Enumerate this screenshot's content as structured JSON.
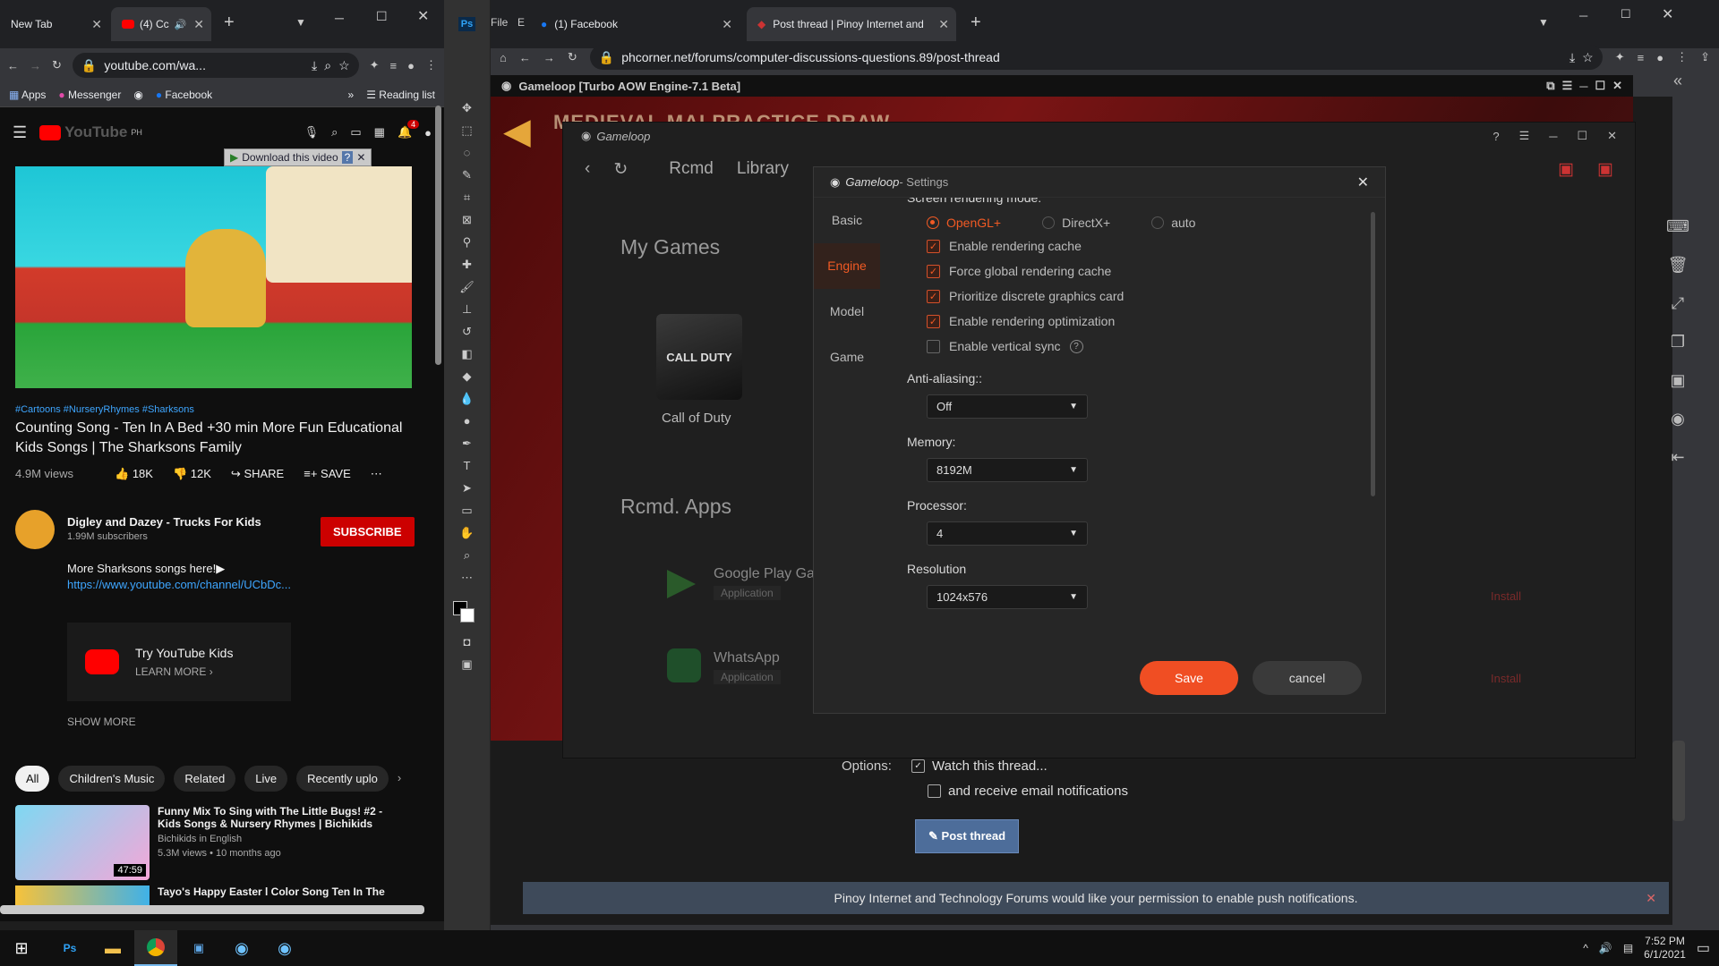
{
  "left_browser": {
    "tabs": [
      {
        "label": "New Tab"
      },
      {
        "label": "(4) Cc"
      }
    ],
    "url": "youtube.com/wa...",
    "bookmarks": {
      "apps": "Apps",
      "messenger": "Messenger",
      "facebook": "Facebook",
      "reading_list": "Reading list"
    },
    "youtube": {
      "region": "PH",
      "notification_count": "4",
      "download_label": "Download this video",
      "tags": "#Cartoons #NurseryRhymes #Sharksons",
      "title": "Counting Song - Ten In A Bed +30 min More Fun Educational Kids Songs | The Sharksons Family",
      "views": "4.9M views",
      "likes": "18K",
      "dislikes": "12K",
      "share": "SHARE",
      "save": "SAVE",
      "channel": "Digley and Dazey - Trucks For Kids",
      "subscribers": "1.99M subscribers",
      "subscribe": "SUBSCRIBE",
      "description": "More Sharksons songs here!▶",
      "description_link": "https://www.youtube.com/channel/UCbDc...",
      "kids_title": "Try YouTube Kids",
      "kids_cta": "LEARN MORE",
      "show_more": "SHOW MORE",
      "chips": [
        "All",
        "Children's Music",
        "Related",
        "Live",
        "Recently uplo"
      ],
      "videos": [
        {
          "title": "Funny Mix To Sing with The Little Bugs! #2 - Kids Songs & Nursery Rhymes | Bichikids",
          "channel": "Bichikids in English",
          "meta": "5.3M views • 10 months ago",
          "duration": "47:59"
        },
        {
          "title": "Tayo's Happy Easter l Color Song Ten In The",
          "channel": "",
          "meta": "",
          "duration": ""
        }
      ]
    }
  },
  "right_browser": {
    "ps_menu": {
      "file": "File",
      "edit": "E"
    },
    "tabs": [
      {
        "label": "(1) Facebook"
      },
      {
        "label": "Post thread | Pinoy Internet and"
      }
    ],
    "url": "phcorner.net/forums/computer-discussions-questions.89/post-thread",
    "options_label": "Options:",
    "watch_thread": "Watch this thread...",
    "email_notifications": "and receive email notifications",
    "post_thread": "Post thread",
    "push_notice": "Pinoy Internet and Technology Forums would like your permission to enable push notifications."
  },
  "gameloop": {
    "window_title": "Gameloop  [Turbo AOW Engine-7.1 Beta]",
    "banner_text": "MEDIEVAL MALPRACTICE DRAW",
    "inner_title": "Gameloop",
    "nav": {
      "rcmd": "Rcmd",
      "library": "Library"
    },
    "my_games": "My Games",
    "game_name": "Call of Duty",
    "cod_logo": "CALL DUTY",
    "rcmd_apps": "Rcmd. Apps",
    "apps": [
      {
        "name": "Google Play Ga",
        "type": "Application",
        "install": "Install"
      },
      {
        "name": "WhatsApp",
        "type": "Application",
        "install": "Install"
      }
    ]
  },
  "settings": {
    "title_brand": "Gameloop",
    "title_suffix": " - Settings",
    "nav": [
      "Basic",
      "Engine",
      "Model",
      "Game"
    ],
    "section_heading": "Screen rendering mode:",
    "render_modes": [
      "OpenGL+",
      "DirectX+",
      "auto"
    ],
    "checkboxes": [
      {
        "label": "Enable rendering cache",
        "checked": true
      },
      {
        "label": "Force global rendering cache",
        "checked": true
      },
      {
        "label": "Prioritize discrete graphics card",
        "checked": true
      },
      {
        "label": "Enable rendering optimization",
        "checked": true
      },
      {
        "label": "Enable vertical sync",
        "checked": false
      }
    ],
    "antialias_label": "Anti-aliasing::",
    "antialias_value": "Off",
    "memory_label": "Memory:",
    "memory_value": "8192M",
    "processor_label": "Processor:",
    "processor_value": "4",
    "resolution_label": "Resolution",
    "resolution_value": "1024x576",
    "save": "Save",
    "cancel": "cancel",
    "accent": "#f04e23"
  },
  "taskbar": {
    "time": "7:52 PM",
    "date": "6/1/2021",
    "ps_label": "Ps"
  }
}
